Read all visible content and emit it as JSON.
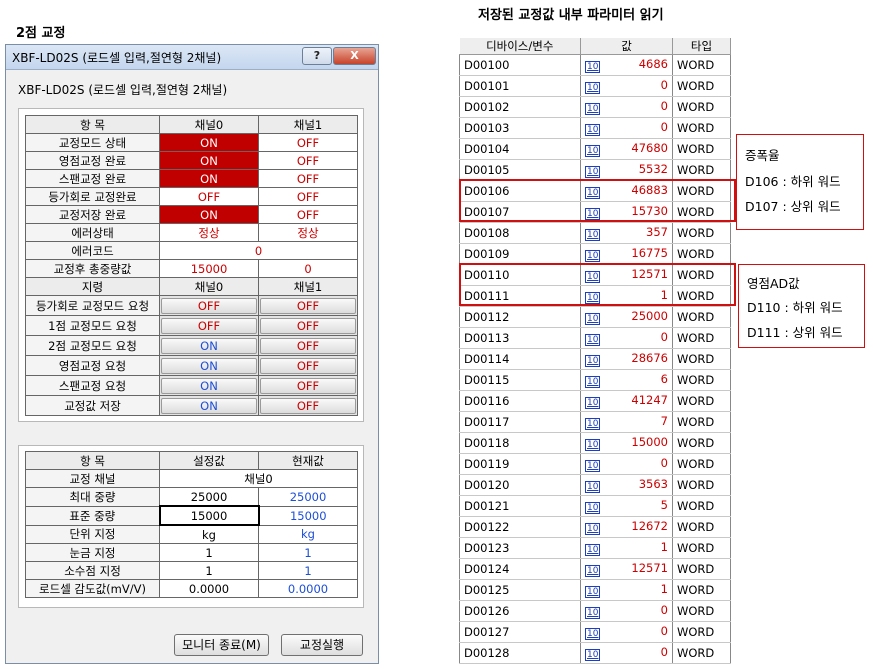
{
  "left_heading": "2점 교정",
  "right_heading": "저장된 교정값 내부 파라미터 읽기",
  "dialog": {
    "title": "XBF-LD02S (로드셀 입력,절연형 2채널)",
    "help_label": "?",
    "close_label": "X",
    "subtitle": "XBF-LD02S (로드셀 입력,절연형 2채널)",
    "status": {
      "header": [
        "항 목",
        "채널0",
        "채널1"
      ],
      "rows": [
        {
          "label": "교정모드 상태",
          "ch0": "ON",
          "ch1": "OFF"
        },
        {
          "label": "영점교정 완료",
          "ch0": "ON",
          "ch1": "OFF"
        },
        {
          "label": "스팬교정 완료",
          "ch0": "ON",
          "ch1": "OFF"
        },
        {
          "label": "등가회로 교정완료",
          "ch0": "OFF",
          "ch1": "OFF"
        },
        {
          "label": "교정저장 완료",
          "ch0": "ON",
          "ch1": "OFF"
        }
      ],
      "error_state": {
        "label": "에러상태",
        "ch0": "정상",
        "ch1": "정상"
      },
      "error_code": {
        "label": "에러코드",
        "value": "0"
      },
      "total_weight": {
        "label": "교정후 총중량값",
        "ch0": "15000",
        "ch1": "0"
      }
    },
    "commands": {
      "header": [
        "지령",
        "채널0",
        "채널1"
      ],
      "rows": [
        {
          "label": "등가회로 교정모드 요청",
          "ch0": "OFF",
          "ch1": "OFF"
        },
        {
          "label": "1점 교정모드 요청",
          "ch0": "OFF",
          "ch1": "OFF"
        },
        {
          "label": "2점 교정모드 요청",
          "ch0": "ON",
          "ch1": "OFF"
        },
        {
          "label": "영점교정 요청",
          "ch0": "ON",
          "ch1": "OFF"
        },
        {
          "label": "스팬교정 요청",
          "ch0": "ON",
          "ch1": "OFF"
        },
        {
          "label": "교정값 저장",
          "ch0": "ON",
          "ch1": "OFF"
        }
      ]
    },
    "settings": {
      "header": [
        "항 목",
        "설정값",
        "현재값"
      ],
      "channel": {
        "label": "교정 채널",
        "value": "채널0"
      },
      "rows": [
        {
          "label": "최대 중량",
          "set": "25000",
          "cur": "25000"
        },
        {
          "label": "표준 중량",
          "set": "15000",
          "cur": "15000"
        },
        {
          "label": "단위 지정",
          "set": "kg",
          "cur": "kg"
        },
        {
          "label": "눈금 지정",
          "set": "1",
          "cur": "1"
        },
        {
          "label": "소수점 지정",
          "set": "1",
          "cur": "1"
        },
        {
          "label": "로드셀 감도값(mV/V)",
          "set": "0.0000",
          "cur": "0.0000"
        }
      ]
    },
    "buttons": {
      "monitor_exit": "모니터 종료(M)",
      "calibrate": "교정실행"
    }
  },
  "params": {
    "header": [
      "디바이스/변수",
      "값",
      "타입"
    ],
    "icon_text": "10",
    "rows": [
      {
        "dev": "D00100",
        "val": "4686",
        "type": "WORD"
      },
      {
        "dev": "D00101",
        "val": "0",
        "type": "WORD"
      },
      {
        "dev": "D00102",
        "val": "0",
        "type": "WORD"
      },
      {
        "dev": "D00103",
        "val": "0",
        "type": "WORD"
      },
      {
        "dev": "D00104",
        "val": "47680",
        "type": "WORD"
      },
      {
        "dev": "D00105",
        "val": "5532",
        "type": "WORD"
      },
      {
        "dev": "D00106",
        "val": "46883",
        "type": "WORD"
      },
      {
        "dev": "D00107",
        "val": "15730",
        "type": "WORD"
      },
      {
        "dev": "D00108",
        "val": "357",
        "type": "WORD"
      },
      {
        "dev": "D00109",
        "val": "16775",
        "type": "WORD"
      },
      {
        "dev": "D00110",
        "val": "12571",
        "type": "WORD"
      },
      {
        "dev": "D00111",
        "val": "1",
        "type": "WORD"
      },
      {
        "dev": "D00112",
        "val": "25000",
        "type": "WORD"
      },
      {
        "dev": "D00113",
        "val": "0",
        "type": "WORD"
      },
      {
        "dev": "D00114",
        "val": "28676",
        "type": "WORD"
      },
      {
        "dev": "D00115",
        "val": "6",
        "type": "WORD"
      },
      {
        "dev": "D00116",
        "val": "41247",
        "type": "WORD"
      },
      {
        "dev": "D00117",
        "val": "7",
        "type": "WORD"
      },
      {
        "dev": "D00118",
        "val": "15000",
        "type": "WORD"
      },
      {
        "dev": "D00119",
        "val": "0",
        "type": "WORD"
      },
      {
        "dev": "D00120",
        "val": "3563",
        "type": "WORD"
      },
      {
        "dev": "D00121",
        "val": "5",
        "type": "WORD"
      },
      {
        "dev": "D00122",
        "val": "12672",
        "type": "WORD"
      },
      {
        "dev": "D00123",
        "val": "1",
        "type": "WORD"
      },
      {
        "dev": "D00124",
        "val": "12571",
        "type": "WORD"
      },
      {
        "dev": "D00125",
        "val": "1",
        "type": "WORD"
      },
      {
        "dev": "D00126",
        "val": "0",
        "type": "WORD"
      },
      {
        "dev": "D00127",
        "val": "0",
        "type": "WORD"
      },
      {
        "dev": "D00128",
        "val": "0",
        "type": "WORD"
      }
    ]
  },
  "annotations": {
    "gain": {
      "title": "증폭율",
      "line1": "D106 : 하위 워드",
      "line2": "D107 : 상위 워드"
    },
    "zero": {
      "title": "영점AD값",
      "line1": "D110 : 하위 워드",
      "line2": "D111 : 상위 워드"
    }
  },
  "colors": {
    "on_bg": "#c00000",
    "off_text": "#cc0000",
    "on_text": "#1d4ed8",
    "highlight": "#d01010"
  }
}
